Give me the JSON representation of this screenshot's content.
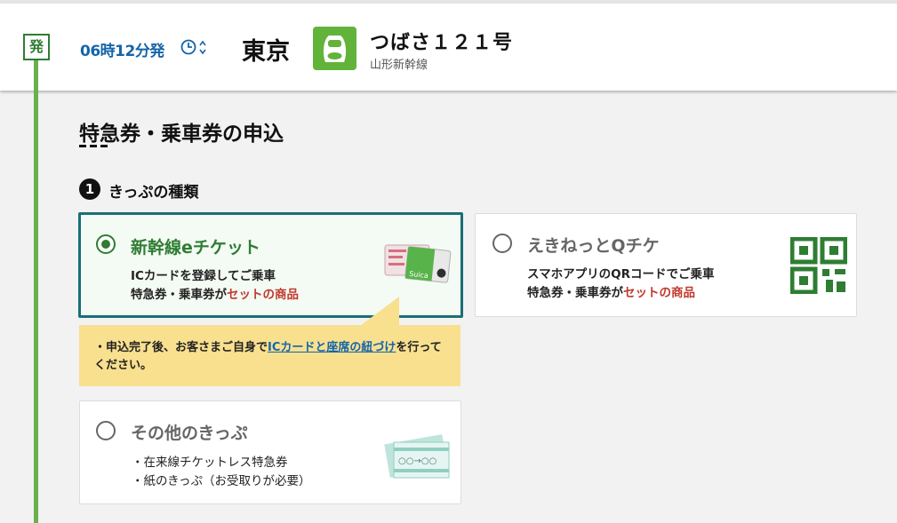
{
  "header": {
    "badge": "発",
    "departure_time": "06時12分発",
    "station": "東京",
    "train_name": "つばさ１２１号",
    "train_line": "山形新幹線"
  },
  "page_title": "特急券・乗車券の申込",
  "section": {
    "number": "1",
    "title": "きっぷの種類"
  },
  "options": [
    {
      "title": "新幹線eチケット",
      "line1": "ICカードを登録してご乗車",
      "line2_prefix": "特急券・乗車券が",
      "line2_highlight": "セットの商品",
      "selected": true
    },
    {
      "title": "えきねっとQチケ",
      "line1": "スマホアプリのQRコードでご乗車",
      "line2_prefix": "特急券・乗車券が",
      "line2_highlight": "セットの商品",
      "selected": false
    },
    {
      "title": "その他のきっぷ",
      "line1": "・在来線チケットレス特急券",
      "line2": "・紙のきっぷ（お受取りが必要）",
      "selected": false
    }
  ],
  "note": {
    "prefix": "・申込完了後、お客さまご自身で",
    "link": "ICカードと座席の紐づけ",
    "suffix": "を行ってください。"
  },
  "ticket_image_text": {
    "sample": "○○→○○"
  },
  "colors": {
    "accent_green": "#2e7d32",
    "link_blue": "#1565a8",
    "highlight_red": "#c0392b",
    "note_yellow": "#f9e08f",
    "selected_border": "#1a6f76"
  }
}
